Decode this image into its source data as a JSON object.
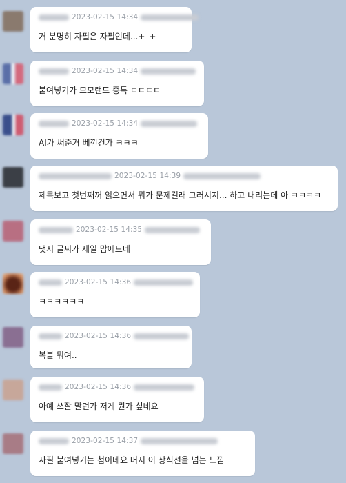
{
  "messages": [
    {
      "timestamp": "2023-02-15 14:34",
      "text": "거 분명히 자필은 자필인데...+_+",
      "avatar_color": "#8a7a6e"
    },
    {
      "timestamp": "2023-02-15 14:34",
      "text": "붙여넣기가 모모랜드 종특 ㄷㄷㄷㄷ",
      "avatar_color": "#d46a7e"
    },
    {
      "timestamp": "2023-02-15 14:34",
      "text": "AI가 써준거 베낀건가 ㅋㅋㅋ",
      "avatar_color": "#3a4f8c"
    },
    {
      "timestamp": "2023-02-15 14:39",
      "text": "제목보고 첫번째꺼 읽으면서 뭐가 문제길래 그러시지... 하고 내리는데 아 ㅋㅋㅋㅋ",
      "avatar_color": "#3b3f46"
    },
    {
      "timestamp": "2023-02-15 14:35",
      "text": "냇시 글씨가 제일 맘에드네",
      "avatar_color": "#b86f82"
    },
    {
      "timestamp": "2023-02-15 14:36",
      "text": "ㅋㅋㅋㅋㅋㅋ",
      "avatar_color": "#6b3020"
    },
    {
      "timestamp": "2023-02-15 14:36",
      "text": "복붙 뭐여..",
      "avatar_color": "#8a6f92"
    },
    {
      "timestamp": "2023-02-15 14:36",
      "text": "아예 쓰잘 말던가 저게 뭔가 싶네요",
      "avatar_color": "#c7a79a"
    },
    {
      "timestamp": "2023-02-15 14:37",
      "text": "자필 붙여넣기는 첨이네요 머지 이 상식선을 넘는 느낌",
      "avatar_color": "#a87c86"
    }
  ]
}
